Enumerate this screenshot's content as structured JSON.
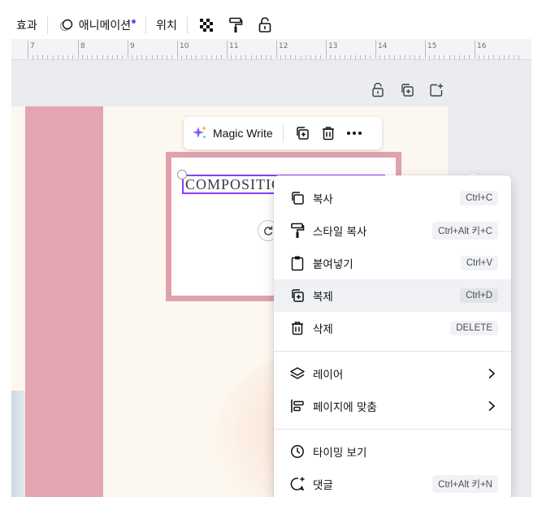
{
  "toolbar": {
    "effects_label": "효과",
    "animate_label": "애니메이션",
    "position_label": "위치"
  },
  "ruler": {
    "marks": [
      "7",
      "8",
      "9",
      "10",
      "11",
      "12",
      "13",
      "14",
      "15",
      "16"
    ]
  },
  "text_element": {
    "content": "COMPOSITIC"
  },
  "floating_toolbar": {
    "magic_write_label": "Magic Write"
  },
  "context_menu": {
    "items": [
      {
        "label": "복사",
        "shortcut": "Ctrl+C",
        "icon": "copy-icon"
      },
      {
        "label": "스타일 복사",
        "shortcut": "Ctrl+Alt 키+C",
        "icon": "paint-roller-icon"
      },
      {
        "label": "붙여넣기",
        "shortcut": "Ctrl+V",
        "icon": "clipboard-icon"
      },
      {
        "label": "복제",
        "shortcut": "Ctrl+D",
        "icon": "duplicate-icon"
      },
      {
        "label": "삭제",
        "shortcut": "DELETE",
        "icon": "trash-icon"
      }
    ],
    "submenus": [
      {
        "label": "레이어",
        "icon": "layers-icon"
      },
      {
        "label": "페이지에 맞춤",
        "icon": "align-icon"
      }
    ],
    "extras": [
      {
        "label": "타이밍 보기",
        "icon": "clock-icon"
      },
      {
        "label": "댓글",
        "shortcut": "Ctrl+Alt 키+N",
        "icon": "comment-add-icon"
      }
    ]
  },
  "colors": {
    "accent": "#8b3dff",
    "stripe_pink": "#e3a5b0",
    "page_bg": "#fdf8ef"
  }
}
